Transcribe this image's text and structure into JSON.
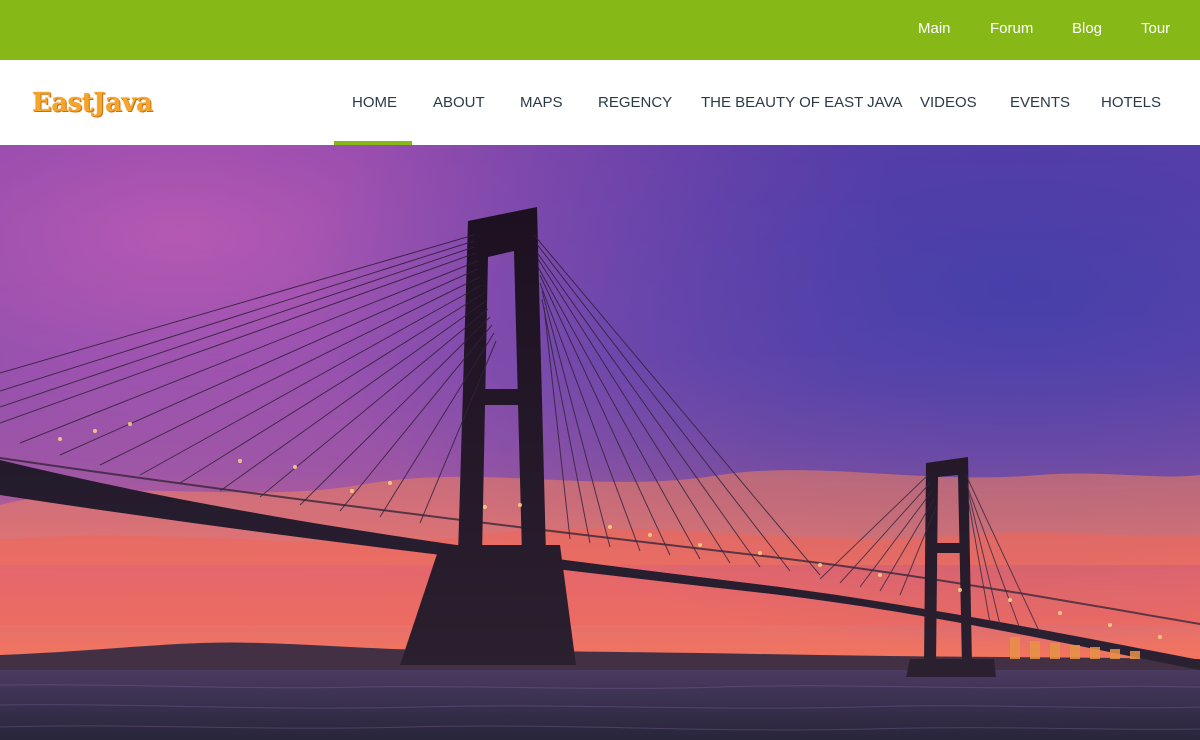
{
  "topbar": {
    "links": [
      {
        "label": "Main"
      },
      {
        "label": "Forum"
      },
      {
        "label": "Blog"
      },
      {
        "label": "Tour"
      }
    ]
  },
  "header": {
    "logo_text": "EastJava",
    "nav": [
      {
        "label": "HOME",
        "active": true
      },
      {
        "label": "ABOUT",
        "active": false
      },
      {
        "label": "MAPS",
        "active": false
      },
      {
        "label": "REGENCY",
        "active": false
      },
      {
        "label": "THE BEAUTY OF EAST JAVA",
        "active": false
      },
      {
        "label": "VIDEOS",
        "active": false
      },
      {
        "label": "EVENTS",
        "active": false
      },
      {
        "label": "HOTELS",
        "active": false
      }
    ]
  },
  "colors": {
    "accent": "#86b817",
    "logo": "#f4a52a",
    "nav_text": "#2b3a46"
  },
  "hero": {
    "image": "cable-stayed bridge at sunset"
  }
}
